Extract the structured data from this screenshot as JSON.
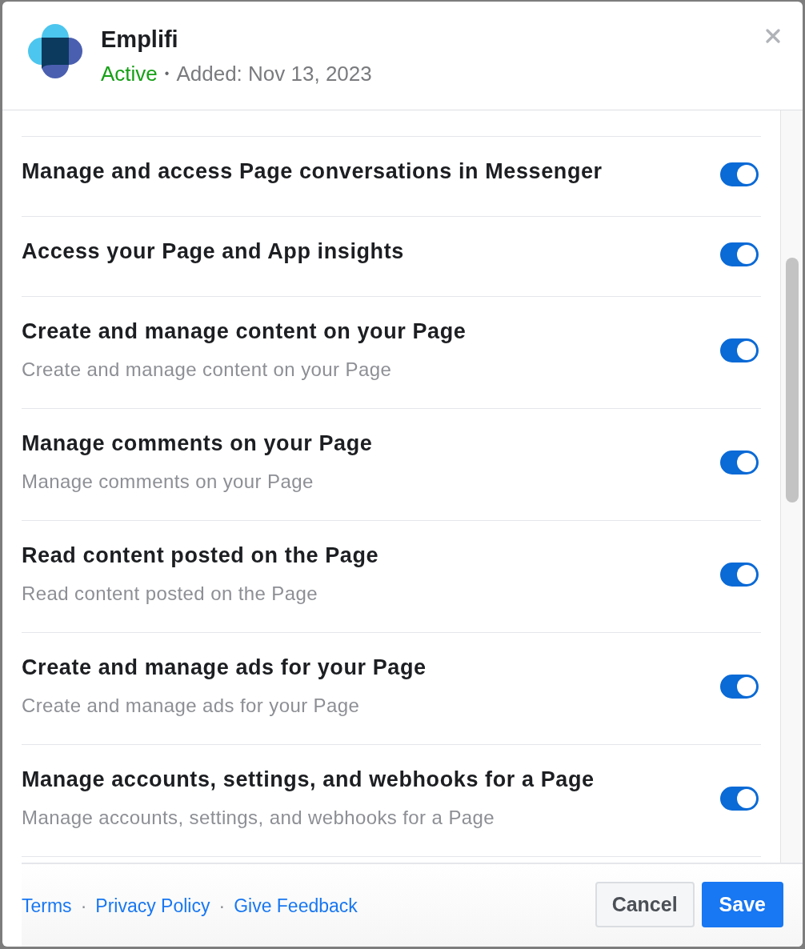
{
  "app": {
    "name": "Emplifi",
    "status": {
      "label": "Active",
      "kind": "active"
    },
    "separator": "•",
    "added": "Added: Nov 13, 2023"
  },
  "permissions": [
    {
      "title": "Manage and access Page conversations in Messenger",
      "on": true
    },
    {
      "title": "Access your Page and App insights",
      "on": true
    },
    {
      "title": "Create and manage content on your Page",
      "description": "Create and manage content on your Page",
      "on": true
    },
    {
      "title": "Manage comments on your Page",
      "description": "Manage comments on your Page",
      "on": true
    },
    {
      "title": "Read content posted on the Page",
      "description": "Read content posted on the Page",
      "on": true
    },
    {
      "title": "Create and manage ads for your Page",
      "description": "Create and manage ads for your Page",
      "on": true
    },
    {
      "title": "Manage accounts, settings, and webhooks for a Page",
      "description": "Manage accounts, settings, and webhooks for a Page",
      "on": true
    }
  ],
  "footer": {
    "items": [
      {
        "kind": "link",
        "label": "Terms"
      },
      {
        "kind": "separator",
        "label": "·"
      },
      {
        "kind": "link",
        "label": "Privacy Policy"
      },
      {
        "kind": "separator",
        "label": "·"
      },
      {
        "kind": "link",
        "label": "Give Feedback"
      }
    ],
    "buttons": [
      {
        "kind": "secondary",
        "label": "Cancel"
      },
      {
        "kind": "primary",
        "label": "Save"
      }
    ]
  }
}
